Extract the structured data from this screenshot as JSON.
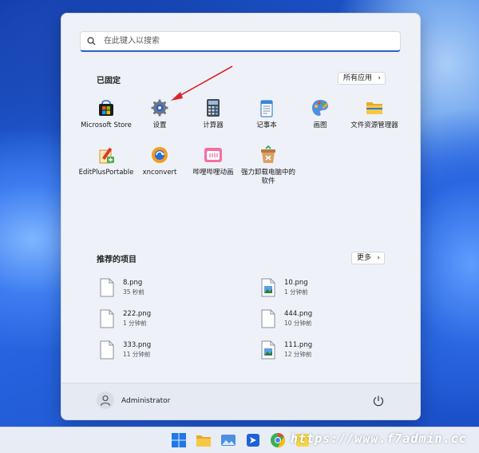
{
  "search": {
    "placeholder": "在此键入以搜索"
  },
  "pinned": {
    "title": "已固定",
    "all_apps_label": "所有应用",
    "apps": [
      {
        "label": "Microsoft Store",
        "icon": "store-icon"
      },
      {
        "label": "设置",
        "icon": "gear-icon"
      },
      {
        "label": "计算器",
        "icon": "calculator-icon"
      },
      {
        "label": "记事本",
        "icon": "notepad-icon"
      },
      {
        "label": "画图",
        "icon": "paint-icon"
      },
      {
        "label": "文件资源管理器",
        "icon": "folder-icon"
      },
      {
        "label": "EditPlusPortable",
        "icon": "editplus-icon"
      },
      {
        "label": "xnconvert",
        "icon": "xnconvert-icon"
      },
      {
        "label": "哔哩哔哩动画",
        "icon": "bilibili-icon"
      },
      {
        "label": "强力卸载电脑中的软件",
        "icon": "uninstall-icon"
      }
    ]
  },
  "recommended": {
    "title": "推荐的项目",
    "more_label": "更多",
    "items": [
      {
        "name": "8.png",
        "time": "35 秒前",
        "icon": "blank-file-icon"
      },
      {
        "name": "10.png",
        "time": "1 分钟前",
        "icon": "image-file-icon"
      },
      {
        "name": "222.png",
        "time": "1 分钟前",
        "icon": "blank-file-icon"
      },
      {
        "name": "444.png",
        "time": "10 分钟前",
        "icon": "blank-file-icon"
      },
      {
        "name": "333.png",
        "time": "11 分钟前",
        "icon": "blank-file-icon"
      },
      {
        "name": "111.png",
        "time": "12 分钟前",
        "icon": "image-file-icon"
      }
    ]
  },
  "user": {
    "name": "Administrator"
  },
  "watermark": "https://www.f7admin.cc",
  "colors": {
    "accent": "#2b63c9",
    "annotation_arrow": "#d9262c"
  }
}
